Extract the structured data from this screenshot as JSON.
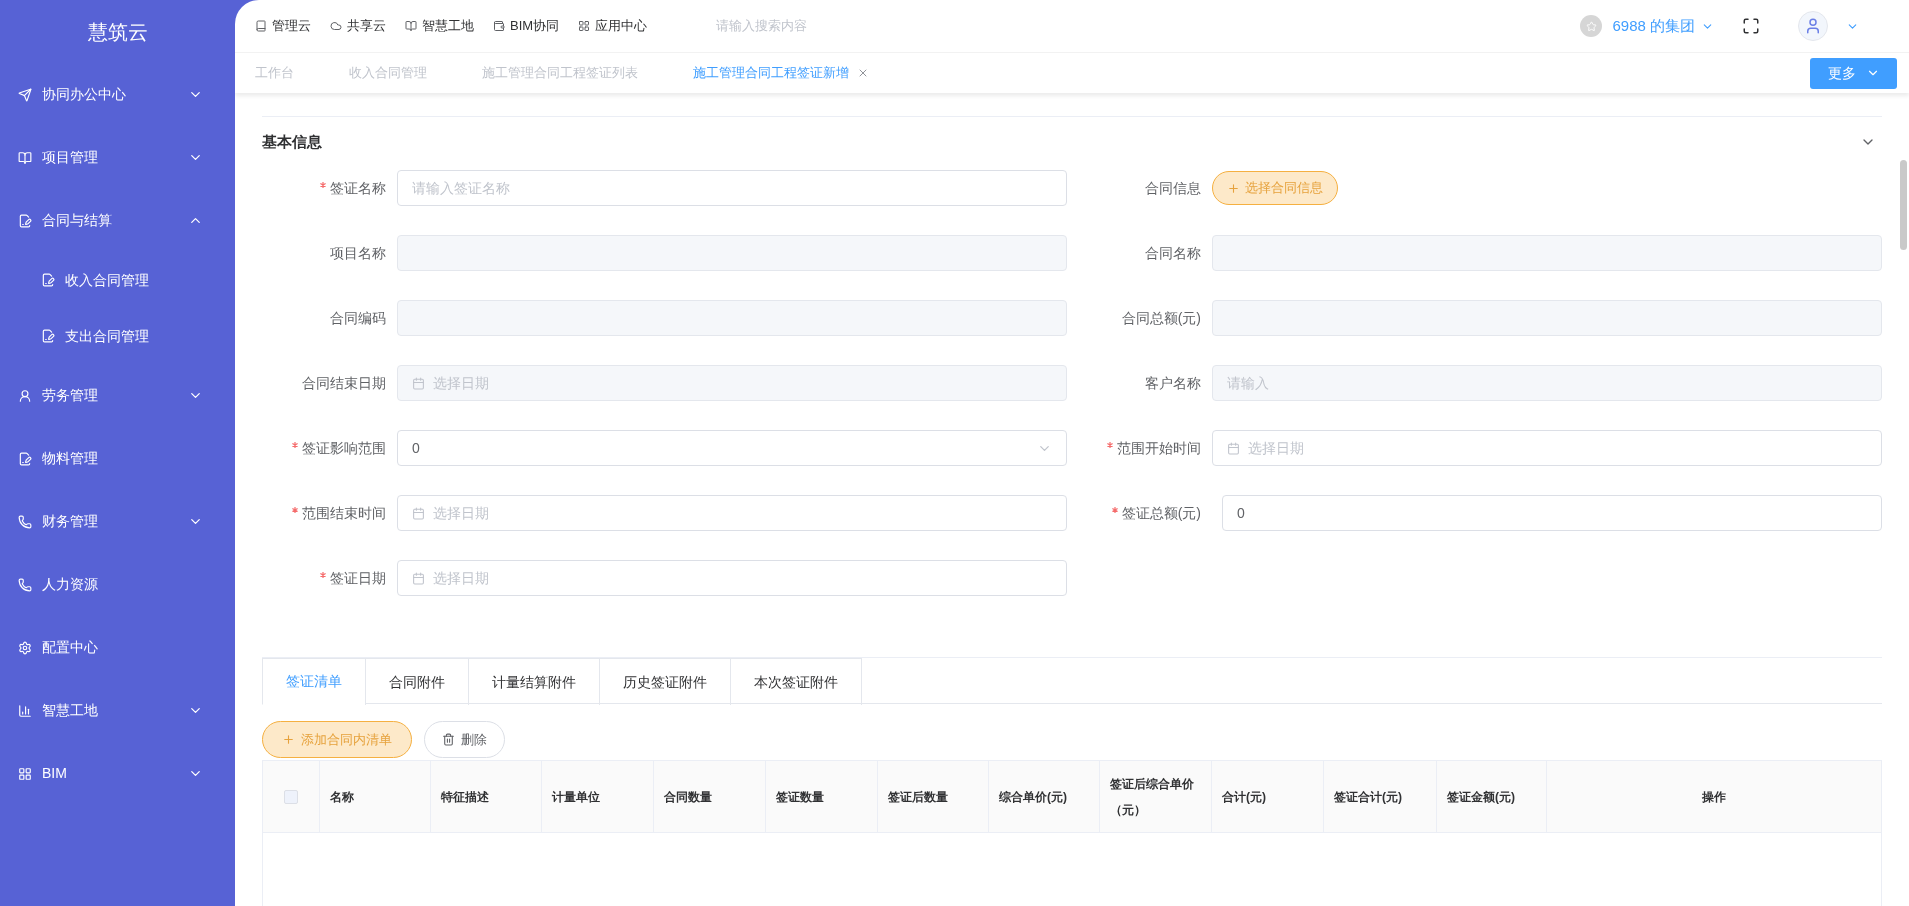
{
  "sidebar": {
    "title": "慧筑云",
    "items": [
      {
        "label": "协同办公中心",
        "expanded": false
      },
      {
        "label": "项目管理",
        "expanded": false
      },
      {
        "label": "合同与结算",
        "expanded": true,
        "children": [
          {
            "label": "收入合同管理"
          },
          {
            "label": "支出合同管理"
          }
        ]
      },
      {
        "label": "劳务管理",
        "expanded": false
      },
      {
        "label": "物料管理"
      },
      {
        "label": "财务管理",
        "expanded": false
      },
      {
        "label": "人力资源"
      },
      {
        "label": "配置中心"
      },
      {
        "label": "智慧工地",
        "expanded": false
      },
      {
        "label": "BIM",
        "expanded": false
      }
    ]
  },
  "top_nav": {
    "links": [
      "管理云",
      "共享云",
      "智慧工地",
      "BIM协同",
      "应用中心"
    ],
    "search": {
      "placeholder": "请输入搜索内容"
    },
    "org": "6988 的集团"
  },
  "page_tabs": {
    "tabs": [
      {
        "label": "工作台",
        "selected": false
      },
      {
        "label": "收入合同管理",
        "selected": false
      },
      {
        "label": "施工管理合同工程签证列表",
        "selected": false
      },
      {
        "label": "施工管理合同工程签证新增",
        "selected": true
      }
    ],
    "more": "更多"
  },
  "section": {
    "title": "基本信息",
    "expanded": true,
    "fields": [
      {
        "label": "签证名称",
        "required": true,
        "kind": "input",
        "placeholder": "请输入签证名称"
      },
      {
        "label": "合同信息",
        "required": false,
        "kind": "button",
        "button": "选择合同信息"
      },
      {
        "label": "项目名称",
        "required": false,
        "kind": "disabled"
      },
      {
        "label": "合同名称",
        "required": false,
        "kind": "disabled"
      },
      {
        "label": "合同编码",
        "required": false,
        "kind": "disabled"
      },
      {
        "label": "合同总额(元)",
        "required": false,
        "kind": "disabled"
      },
      {
        "label": "合同结束日期",
        "required": false,
        "kind": "date_disabled",
        "placeholder": "选择日期"
      },
      {
        "label": "客户名称",
        "required": false,
        "kind": "disabled",
        "placeholder": "请输入"
      },
      {
        "label": "签证影响范围",
        "required": true,
        "kind": "select",
        "value": "0"
      },
      {
        "label": "范围开始时间",
        "required": true,
        "kind": "date",
        "placeholder": "选择日期"
      },
      {
        "label": "范围结束时间",
        "required": true,
        "kind": "date",
        "placeholder": "选择日期"
      },
      {
        "label": "签证总额(元)",
        "required": true,
        "kind": "input",
        "value": "0"
      },
      {
        "label": "签证日期",
        "required": true,
        "kind": "date",
        "placeholder": "选择日期"
      }
    ]
  },
  "detail_tabs": [
    {
      "label": "签证清单",
      "selected": true
    },
    {
      "label": "合同附件",
      "selected": false
    },
    {
      "label": "计量结算附件",
      "selected": false
    },
    {
      "label": "历史签证附件",
      "selected": false
    },
    {
      "label": "本次签证附件",
      "selected": false
    }
  ],
  "actions": {
    "add": "添加合同内清单",
    "delete": "删除"
  },
  "table": {
    "select_all_checked": false,
    "columns": [
      "名称",
      "特征描述",
      "计量单位",
      "合同数量",
      "签证数量",
      "签证后数量",
      "综合单价(元)",
      "签证后综合单价（元）",
      "合计(元)",
      "签证合计(元)",
      "签证金额(元)",
      "操作"
    ]
  }
}
